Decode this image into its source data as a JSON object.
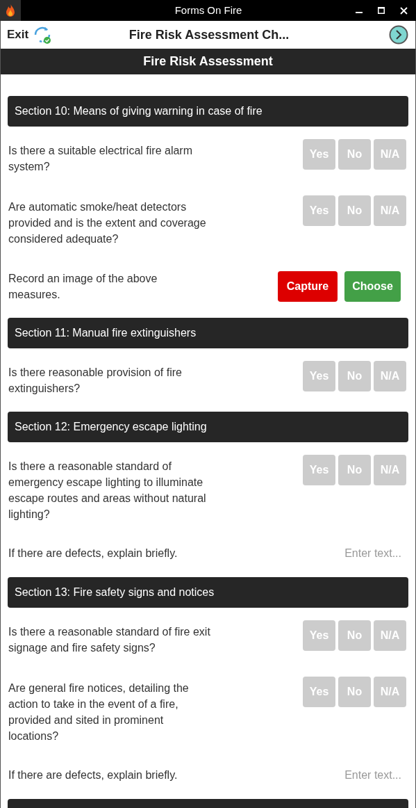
{
  "window": {
    "title": "Forms On Fire"
  },
  "toolbar": {
    "exit": "Exit",
    "title": "Fire Risk Assessment Ch..."
  },
  "page_header": "Fire Risk Assessment",
  "items": [
    {
      "kind": "section",
      "title": "Section 10: Means of giving warning in case of fire"
    },
    {
      "kind": "question",
      "label": "Is there a suitable electrical fire alarm system?",
      "options": [
        {
          "label": "Yes",
          "selected": false
        },
        {
          "label": "No",
          "selected": false
        },
        {
          "label": "N/A",
          "selected": false
        }
      ]
    },
    {
      "kind": "question",
      "label": "Are automatic smoke/heat detectors provided and is the extent and coverage considered adequate?",
      "options": [
        {
          "label": "Yes",
          "selected": false
        },
        {
          "label": "No",
          "selected": false
        },
        {
          "label": "N/A",
          "selected": false
        }
      ]
    },
    {
      "kind": "photo",
      "label": "Record an image of the above measures.",
      "capture": "Capture",
      "choose": "Choose"
    },
    {
      "kind": "section",
      "title": "Section 11: Manual fire extinguishers"
    },
    {
      "kind": "question",
      "label": "Is there reasonable provision of fire extinguishers?",
      "options": [
        {
          "label": "Yes",
          "selected": false
        },
        {
          "label": "No",
          "selected": false
        },
        {
          "label": "N/A",
          "selected": false
        }
      ]
    },
    {
      "kind": "section",
      "title": "Section 12: Emergency escape lighting"
    },
    {
      "kind": "question",
      "label": "Is there a reasonable standard of emergency escape lighting to illuminate escape routes and areas without natural lighting?",
      "options": [
        {
          "label": "Yes",
          "selected": false
        },
        {
          "label": "No",
          "selected": false
        },
        {
          "label": "N/A",
          "selected": false
        }
      ]
    },
    {
      "kind": "text",
      "label": "If there are defects,  explain briefly.",
      "placeholder": "Enter text..."
    },
    {
      "kind": "section",
      "title": "Section 13: Fire safety signs and notices"
    },
    {
      "kind": "question",
      "label": "Is there a reasonable standard of fire exit signage and fire safety signs?",
      "options": [
        {
          "label": "Yes",
          "selected": false
        },
        {
          "label": "No",
          "selected": false
        },
        {
          "label": "N/A",
          "selected": false
        }
      ]
    },
    {
      "kind": "question",
      "label": "Are general fire notices, detailing the action to take in the event of a fire, provided and sited in prominent locations?",
      "options": [
        {
          "label": "Yes",
          "selected": false
        },
        {
          "label": "No",
          "selected": false
        },
        {
          "label": "N/A",
          "selected": false
        }
      ]
    },
    {
      "kind": "text",
      "label": "If there are defects,  explain briefly.",
      "placeholder": "Enter text..."
    }
  ]
}
